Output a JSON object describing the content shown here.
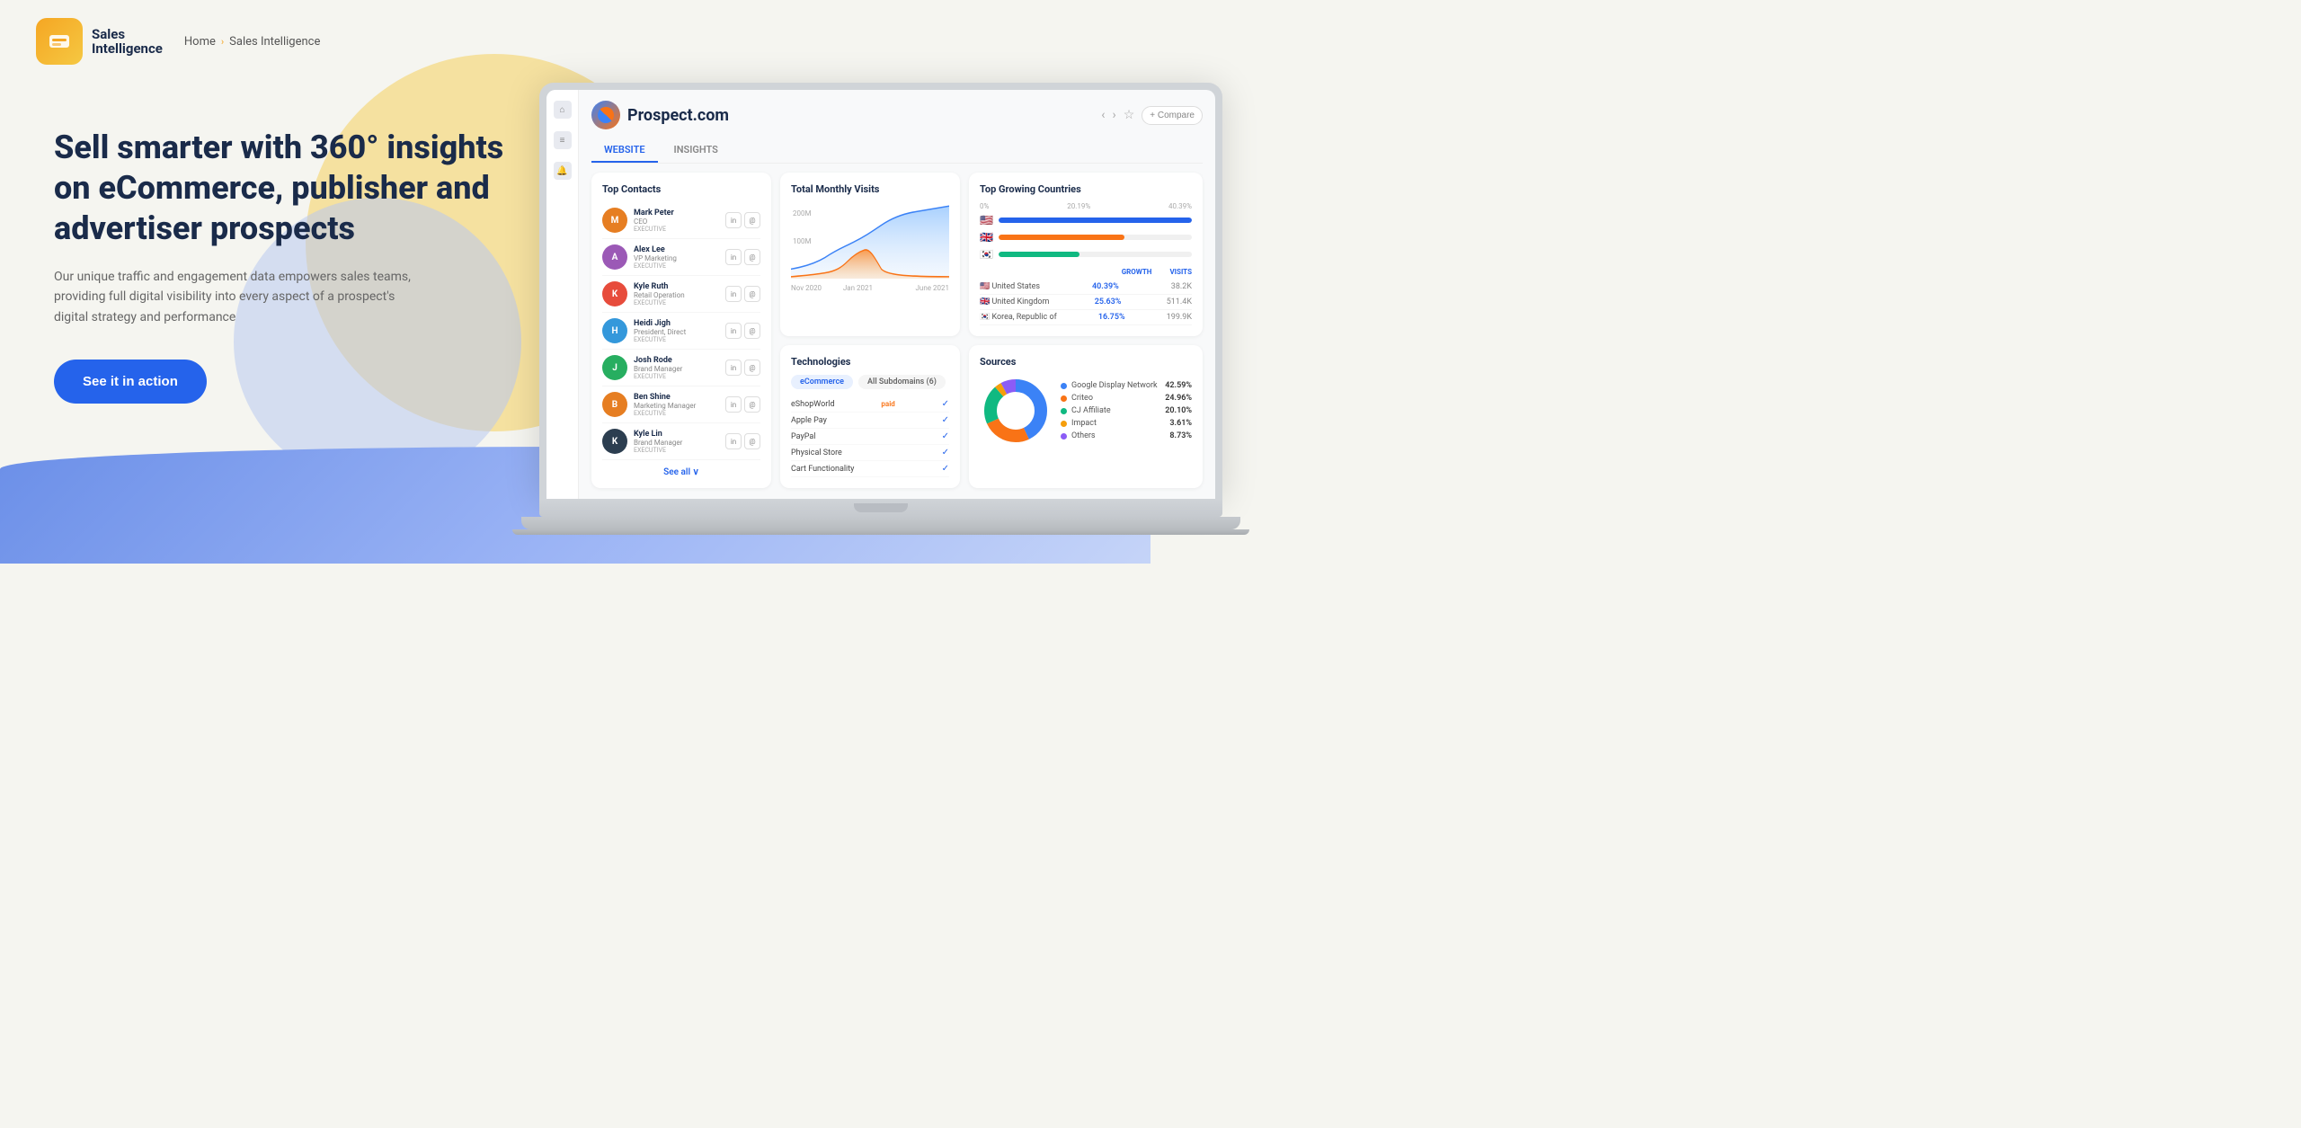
{
  "header": {
    "logo_sales": "Sales",
    "logo_intelligence": "Intelligence",
    "breadcrumb_home": "Home",
    "breadcrumb_chevron": "›",
    "breadcrumb_current": "Sales Intelligence"
  },
  "hero": {
    "title": "Sell smarter with 360° insights on eCommerce, publisher and advertiser prospects",
    "subtitle": "Our unique traffic and engagement data empowers sales teams, providing full digital visibility into every aspect of a prospect's digital strategy and performance",
    "cta_label": "See it in action"
  },
  "dashboard": {
    "company_name": "Prospect.com",
    "tabs": [
      "WEBSITE",
      "INSIGHTS"
    ],
    "active_tab": "WEBSITE",
    "compare_btn": "+ Compare",
    "traffic_card": {
      "title": "Total Monthly Visits",
      "y_labels": [
        "200M",
        "100M"
      ],
      "x_labels": [
        "Nov 2020",
        "Jan 2021",
        "",
        "June 2021"
      ]
    },
    "countries_card": {
      "title": "Top Growing Countries",
      "header_growth": "GROWTH",
      "header_visits": "VISITS",
      "items": [
        {
          "name": "United States",
          "growth": "40.39%",
          "visits": "38.2K",
          "bar_width": "40",
          "color": "#2563eb"
        },
        {
          "name": "United Kingdom",
          "growth": "25.63%",
          "visits": "511.4K",
          "bar_width": "25",
          "color": "#f97316"
        },
        {
          "name": "Korea, Republic of",
          "growth": "16.75%",
          "visits": "199.9K",
          "bar_width": "17",
          "color": "#10b981"
        }
      ]
    },
    "contacts_card": {
      "title": "Top Contacts",
      "see_all": "See all ∨",
      "items": [
        {
          "name": "Mark Peter",
          "title": "CEO",
          "role": "Executive",
          "color": "#e67e22"
        },
        {
          "name": "Alex Lee",
          "title": "VP Marketing",
          "role": "Executive",
          "color": "#9b59b6"
        },
        {
          "name": "Kyle Ruth",
          "title": "Retail Operation",
          "role": "Executive",
          "color": "#e74c3c"
        },
        {
          "name": "Heidi Jigh",
          "title": "President, Direct",
          "role": "Executive",
          "color": "#3498db"
        },
        {
          "name": "Josh Rode",
          "title": "Brand Manager",
          "role": "Executive",
          "color": "#27ae60"
        },
        {
          "name": "Ben Shine",
          "title": "Marketing Manager",
          "role": "Executive",
          "color": "#e67e22"
        },
        {
          "name": "Kyle Lin",
          "title": "Brand Manager",
          "role": "Executive",
          "color": "#2c3e50"
        }
      ]
    },
    "tech_card": {
      "title": "Technologies",
      "tags": [
        "eCommerce",
        "All Subdomains (6)"
      ],
      "items": [
        {
          "name": "eShopWorld",
          "badge": "paid",
          "checked": true
        },
        {
          "name": "Apple Pay",
          "badge": "",
          "checked": true
        },
        {
          "name": "PayPal",
          "badge": "",
          "checked": true
        },
        {
          "name": "Physical Store",
          "badge": "",
          "checked": true
        },
        {
          "name": "Cart Functionality",
          "badge": "",
          "checked": true
        }
      ]
    },
    "sources_card": {
      "title": "Sources",
      "items": [
        {
          "name": "Google Display Network",
          "pct": "42.59%",
          "color": "#3b82f6"
        },
        {
          "name": "Criteo",
          "pct": "24.96%",
          "color": "#f97316"
        },
        {
          "name": "CJ Affiliate",
          "pct": "20.10%",
          "color": "#10b981"
        },
        {
          "name": "Impact",
          "pct": "3.61%",
          "color": "#f59e0b"
        },
        {
          "name": "Others",
          "pct": "8.73%",
          "color": "#8b5cf6"
        }
      ]
    }
  }
}
